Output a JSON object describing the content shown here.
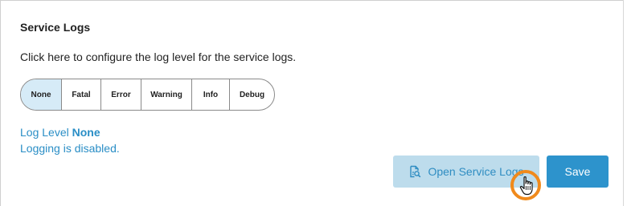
{
  "section": {
    "title": "Service Logs",
    "description": "Click here to configure the log level for the service logs."
  },
  "log_levels": {
    "options": [
      "None",
      "Fatal",
      "Error",
      "Warning",
      "Info",
      "Debug"
    ],
    "selected": "None"
  },
  "status": {
    "log_level_label": "Log Level",
    "log_level_value": "None",
    "message": "Logging is disabled."
  },
  "actions": {
    "open_logs_label": "Open Service Logs",
    "open_logs_icon": "document-search-icon",
    "save_label": "Save"
  },
  "colors": {
    "accent": "#2d93cc",
    "link_text": "#2a8ec6",
    "selected_segment": "#d6ebf7",
    "disabled_button_bg": "#bddcec",
    "cursor_highlight": "#f08a1c"
  }
}
